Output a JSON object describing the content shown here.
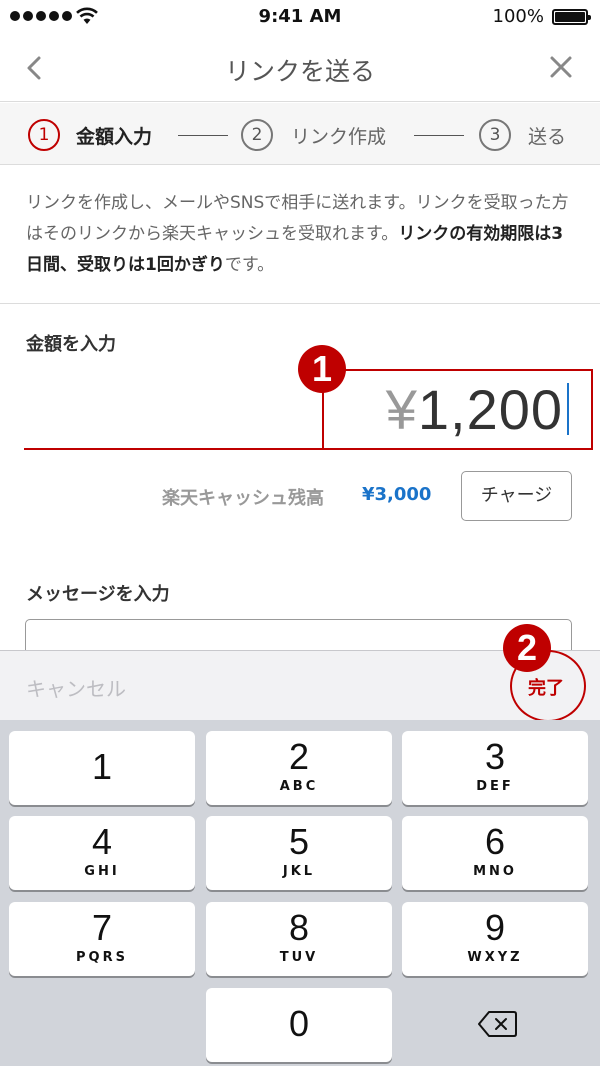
{
  "status_bar": {
    "time": "9:41 AM",
    "battery": "100%"
  },
  "nav": {
    "title": "リンクを送る"
  },
  "stepper": {
    "steps": [
      {
        "number": "1",
        "label": "金額入力"
      },
      {
        "number": "2",
        "label": "リンク作成"
      },
      {
        "number": "3",
        "label": "送る"
      }
    ]
  },
  "description": {
    "part1": "リンクを作成し、メールやSNSで相手に送れます。リンクを受取った方はそのリンクから楽天キャッシュを受取れます。",
    "bold": "リンクの有効期限は3日間、受取りは1回かぎり",
    "part2": "です。"
  },
  "amount": {
    "label": "金額を入力",
    "currency": "¥",
    "value": "1,200"
  },
  "badges": {
    "first": "1",
    "second": "2"
  },
  "balance": {
    "label": "楽天キャッシュ残高",
    "value": "¥3,000",
    "charge_label": "チャージ"
  },
  "message": {
    "label": "メッセージを入力"
  },
  "keyboard": {
    "cancel_label": "キャンセル",
    "done_label": "完了",
    "keys": [
      {
        "num": "1",
        "letters": ""
      },
      {
        "num": "2",
        "letters": "ABC"
      },
      {
        "num": "3",
        "letters": "DEF"
      },
      {
        "num": "4",
        "letters": "GHI"
      },
      {
        "num": "5",
        "letters": "JKL"
      },
      {
        "num": "6",
        "letters": "MNO"
      },
      {
        "num": "7",
        "letters": "PQRS"
      },
      {
        "num": "8",
        "letters": "TUV"
      },
      {
        "num": "9",
        "letters": "WXYZ"
      },
      {
        "num": "0",
        "letters": ""
      }
    ]
  },
  "colors": {
    "accent": "#bf0000",
    "link": "#1a73c9",
    "keypad_bg": "#d1d4da"
  }
}
